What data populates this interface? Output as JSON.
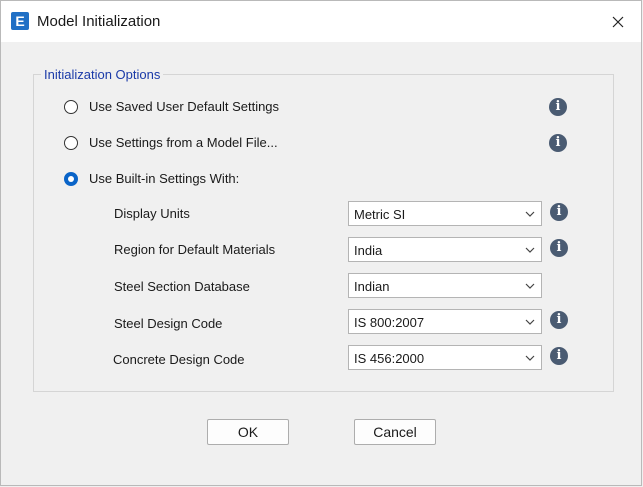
{
  "window": {
    "title": "Model Initialization",
    "app_icon_letter": "E"
  },
  "group": {
    "legend": "Initialization Options"
  },
  "options": [
    {
      "label": "Use Saved User Default Settings",
      "checked": false
    },
    {
      "label": "Use Settings from a Model File...",
      "checked": false
    },
    {
      "label": "Use Built-in Settings With:",
      "checked": true
    }
  ],
  "fields": [
    {
      "label": "Display Units",
      "value": "Metric SI",
      "has_info": true
    },
    {
      "label": "Region for Default Materials",
      "value": "India",
      "has_info": true
    },
    {
      "label": "Steel Section Database",
      "value": "Indian",
      "has_info": false
    },
    {
      "label": "Steel Design Code",
      "value": "IS 800:2007",
      "has_info": true
    },
    {
      "label": "Concrete Design Code",
      "value": "IS 456:2000",
      "has_info": true
    }
  ],
  "buttons": {
    "ok": "OK",
    "cancel": "Cancel"
  },
  "icons": {
    "info": "info-icon",
    "close": "close-icon",
    "dropdown": "chevron-down-icon"
  },
  "colors": {
    "accent": "#0a64c8",
    "legend": "#1a3aa8",
    "info_icon": "#4a5b72",
    "app_icon": "#1f6fc5"
  }
}
